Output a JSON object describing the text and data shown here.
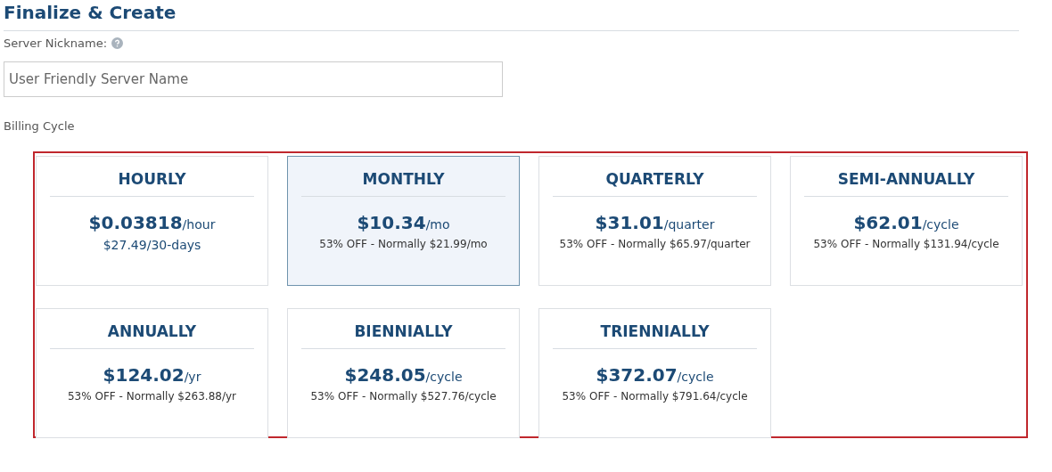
{
  "title": "Finalize & Create",
  "nickname": {
    "label": "Server Nickname:",
    "placeholder": "User Friendly Server Name"
  },
  "billing_cycle": {
    "label": "Billing Cycle",
    "options": [
      {
        "name": "HOURLY",
        "price": "$0.03818",
        "unit": "/hour",
        "note": "$27.49/30-days",
        "kind": "estimate",
        "selected": false
      },
      {
        "name": "MONTHLY",
        "price": "$10.34",
        "unit": "/mo",
        "note": "53% OFF - Normally $21.99/mo",
        "kind": "discount",
        "selected": true
      },
      {
        "name": "QUARTERLY",
        "price": "$31.01",
        "unit": "/quarter",
        "note": "53% OFF - Normally $65.97/quarter",
        "kind": "discount",
        "selected": false
      },
      {
        "name": "SEMI-ANNUALLY",
        "price": "$62.01",
        "unit": "/cycle",
        "note": "53% OFF - Normally $131.94/cycle",
        "kind": "discount",
        "selected": false
      },
      {
        "name": "ANNUALLY",
        "price": "$124.02",
        "unit": "/yr",
        "note": "53% OFF - Normally $263.88/yr",
        "kind": "discount",
        "selected": false
      },
      {
        "name": "BIENNIALLY",
        "price": "$248.05",
        "unit": "/cycle",
        "note": "53% OFF - Normally $527.76/cycle",
        "kind": "discount",
        "selected": false
      },
      {
        "name": "TRIENNIALLY",
        "price": "$372.07",
        "unit": "/cycle",
        "note": "53% OFF - Normally $791.64/cycle",
        "kind": "discount",
        "selected": false
      }
    ]
  }
}
